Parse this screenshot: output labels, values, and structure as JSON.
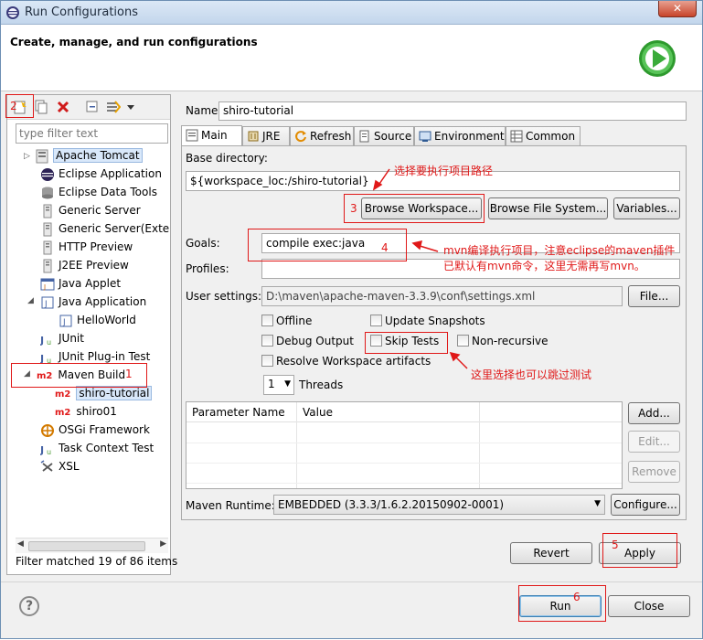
{
  "window": {
    "title": "Run Configurations",
    "close_glyph": "✕"
  },
  "header": {
    "heading": "Create, manage, and run configurations"
  },
  "left": {
    "toolbar": {
      "icons": [
        "new-config-icon",
        "duplicate-icon",
        "delete-icon",
        "collapse-all-icon",
        "filter-icon",
        "view-menu-icon"
      ]
    },
    "filter_placeholder": "type filter text",
    "tree": [
      {
        "label": "Apache Tomcat",
        "icon": "tomcat-icon",
        "expander": "▷"
      },
      {
        "label": "Eclipse Application",
        "icon": "eclipse-icon"
      },
      {
        "label": "Eclipse Data Tools",
        "icon": "database-icon"
      },
      {
        "label": "Generic Server",
        "icon": "server-icon"
      },
      {
        "label": "Generic Server(External",
        "icon": "server-icon"
      },
      {
        "label": "HTTP Preview",
        "icon": "server-icon"
      },
      {
        "label": "J2EE Preview",
        "icon": "server-icon"
      },
      {
        "label": "Java Applet",
        "icon": "applet-icon"
      },
      {
        "label": "Java Application",
        "icon": "java-app-icon",
        "expander": "◢"
      },
      {
        "label": "HelloWorld",
        "icon": "java-app-icon"
      },
      {
        "label": "JUnit",
        "icon": "junit-icon"
      },
      {
        "label": "JUnit Plug-in Test",
        "icon": "junit-icon"
      },
      {
        "label": "Maven Build",
        "icon": "m2-icon",
        "expander": "◢",
        "badge": "m2"
      },
      {
        "label": "shiro-tutorial",
        "icon": "m2-icon",
        "badge": "m2"
      },
      {
        "label": "shiro01",
        "icon": "m2-icon",
        "badge": "m2"
      },
      {
        "label": "OSGi Framework",
        "icon": "osgi-icon"
      },
      {
        "label": "Task Context Test",
        "icon": "junit-icon"
      },
      {
        "label": "XSL",
        "icon": "xsl-icon"
      }
    ],
    "status": "Filter matched 19 of 86 items"
  },
  "config": {
    "name_label": "Name:",
    "name_value": "shiro-tutorial",
    "tabs": [
      {
        "label": "Main",
        "icon": "main-tab-icon"
      },
      {
        "label": "JRE",
        "icon": "jre-tab-icon"
      },
      {
        "label": "Refresh",
        "icon": "refresh-tab-icon"
      },
      {
        "label": "Source",
        "icon": "source-tab-icon"
      },
      {
        "label": "Environment",
        "icon": "environment-tab-icon"
      },
      {
        "label": "Common",
        "icon": "common-tab-icon"
      }
    ],
    "base_dir_label": "Base directory:",
    "base_dir_value": "${workspace_loc:/shiro-tutorial}",
    "browse_workspace": "Browse Workspace...",
    "browse_fs": "Browse File System...",
    "variables": "Variables...",
    "goals_label": "Goals:",
    "goals_value": "compile exec:java",
    "profiles_label": "Profiles:",
    "profiles_value": "",
    "user_settings_label": "User settings:",
    "user_settings_value": "D:\\maven\\apache-maven-3.3.9\\conf\\settings.xml",
    "file_btn": "File...",
    "checkboxes": {
      "offline": "Offline",
      "update_snapshots": "Update Snapshots",
      "debug_output": "Debug Output",
      "skip_tests": "Skip Tests",
      "non_recursive": "Non-recursive",
      "resolve_workspace": "Resolve Workspace artifacts"
    },
    "threads_value": "1",
    "threads_label": "Threads",
    "table": {
      "col_name": "Parameter Name",
      "col_value": "Value"
    },
    "add_btn": "Add...",
    "edit_btn": "Edit...",
    "remove_btn": "Remove",
    "runtime_label": "Maven Runtime:",
    "runtime_value": "EMBEDDED (3.3.3/1.6.2.20150902-0001)",
    "configure_btn": "Configure...",
    "revert_btn": "Revert",
    "apply_btn": "Apply"
  },
  "footer": {
    "help": "?",
    "run_btn": "Run",
    "close_btn": "Close"
  },
  "annotations": {
    "n1": "1",
    "n2": "2",
    "n3": "3",
    "n4": "4",
    "n5": "5",
    "n6": "6",
    "note_path": "选择要执行项目路径",
    "note_mvn_1": "mvn编译执行项目，注意eclipse的maven插件",
    "note_mvn_2": "已默认有mvn命令，这里无需再写mvn。",
    "note_skip": "这里选择也可以跳过测试",
    "color": "#e01818"
  }
}
